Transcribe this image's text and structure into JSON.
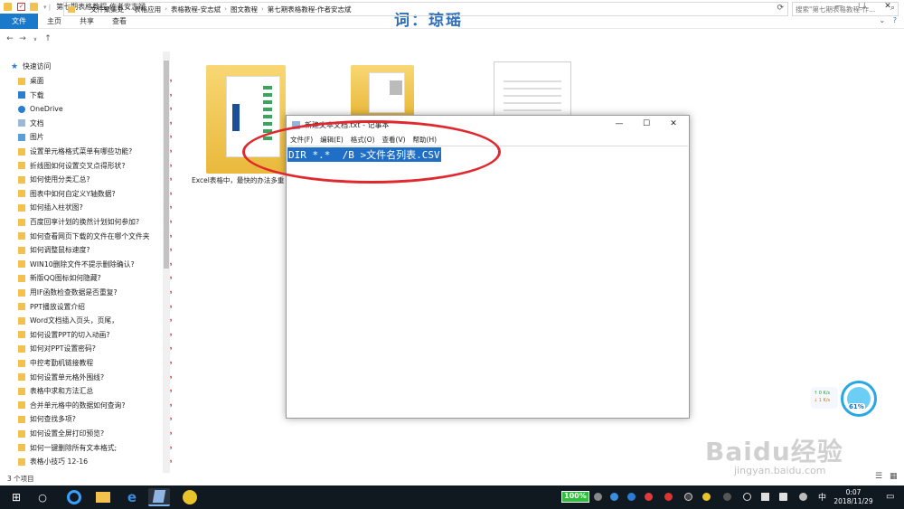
{
  "window": {
    "title": "第七期表格教程-作者安志斌",
    "caption": "词：琼瑶",
    "controls": {
      "minimize": "—",
      "maximize": "☐",
      "close": "✕"
    }
  },
  "ribbon": {
    "tabs": [
      "文件",
      "主页",
      "共享",
      "查看"
    ],
    "help": "?"
  },
  "address": {
    "crumbs": [
      "文件聚集处",
      "表格应用",
      "表格教程-安志斌",
      "图文教程",
      "第七期表格教程-作者安志斌"
    ],
    "search_placeholder": "搜索\"第七期表格教程-作..."
  },
  "sidebar": {
    "quick_access": "快速访问",
    "items": [
      {
        "label": "桌面",
        "icon": "folder-icon"
      },
      {
        "label": "下载",
        "icon": "download-icon"
      },
      {
        "label": "OneDrive",
        "icon": "onedrive-icon"
      },
      {
        "label": "文档",
        "icon": "document-icon"
      },
      {
        "label": "图片",
        "icon": "picture-icon"
      },
      {
        "label": "设置单元格格式菜单有哪些功能?",
        "icon": "folder-icon"
      },
      {
        "label": "折线图如何设置交叉点得形状?",
        "icon": "folder-icon"
      },
      {
        "label": "如何使用分类汇总?",
        "icon": "folder-icon"
      },
      {
        "label": "图表中如何自定义Y轴数据?",
        "icon": "folder-icon"
      },
      {
        "label": "如何插入柱状图?",
        "icon": "folder-icon"
      },
      {
        "label": "百度回享计划的换然计划如何参加?",
        "icon": "folder-icon"
      },
      {
        "label": "如何查看网页下载的文件在哪个文件夹",
        "icon": "folder-icon"
      },
      {
        "label": "如何调整鼠标速度?",
        "icon": "folder-icon"
      },
      {
        "label": "WIN10删除文件不提示删除确认?",
        "icon": "folder-icon"
      },
      {
        "label": "新版QQ图标如何隐藏?",
        "icon": "folder-icon"
      },
      {
        "label": "用IF函数检查数据是否重复?",
        "icon": "folder-icon"
      },
      {
        "label": "PPT播放设置介绍",
        "icon": "folder-icon"
      },
      {
        "label": "Word文档插入页头，页尾，",
        "icon": "folder-icon"
      },
      {
        "label": "如何设置PPT的切入动画?",
        "icon": "folder-icon"
      },
      {
        "label": "如何对PPT设置密码?",
        "icon": "folder-icon"
      },
      {
        "label": "中控考勤机链接教程",
        "icon": "folder-icon"
      },
      {
        "label": "如何设置单元格外围线?",
        "icon": "folder-icon"
      },
      {
        "label": "表格中求和方法汇总",
        "icon": "folder-icon"
      },
      {
        "label": "合并单元格中的数据如何查询?",
        "icon": "folder-icon"
      },
      {
        "label": "如何查找多项?",
        "icon": "folder-icon"
      },
      {
        "label": "如何设置全屏打印预览?",
        "icon": "folder-icon"
      },
      {
        "label": "如何一键删除所有文本格式;",
        "icon": "folder-icon"
      },
      {
        "label": "表格小技巧 12-16",
        "icon": "folder-icon"
      }
    ]
  },
  "status": {
    "item_count": "3 个项目"
  },
  "files": [
    {
      "label": "Excel表格中，最快的办法多重"
    }
  ],
  "notepad": {
    "title": "新建文本文档.txt - 记事本",
    "menu": [
      "文件(F)",
      "编辑(E)",
      "格式(O)",
      "查看(V)",
      "帮助(H)"
    ],
    "content": "DIR *.*  /B >文件名列表.CSV"
  },
  "speed_widget": {
    "up": "↑ 0  K/s",
    "down": "↓ 1  K/s",
    "percent": "61%"
  },
  "watermark": {
    "logo": "Baidu经验",
    "url": "jingyan.baidu.com"
  },
  "taskbar": {
    "battery": "100%",
    "ime": "中",
    "time": "0:07",
    "date": "2018/11/29"
  },
  "colors": {
    "accent": "#1979ca",
    "annotation": "#e0282f",
    "selection": "#1f6fc7"
  }
}
